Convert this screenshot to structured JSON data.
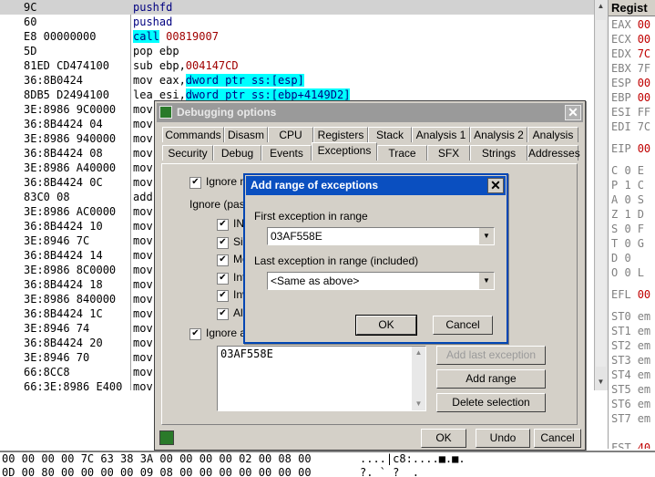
{
  "disasm": {
    "rows": [
      {
        "hex": "9C",
        "ins": "pushfd"
      },
      {
        "hex": "60",
        "ins": "pushad"
      },
      {
        "hex": "E8 00000000",
        "ins_kw": "call",
        "ins_arg": " 00819007"
      },
      {
        "hex": "5D",
        "ins": "pop ebp"
      },
      {
        "hex": "81ED CD474100",
        "ins": "sub ebp,",
        "ins_arg2": "004147CD"
      },
      {
        "hex": "36:8B0424",
        "ins": "mov eax,",
        "ins_hl": "dword ptr ss:[esp]"
      },
      {
        "hex": "8DB5 D2494100",
        "ins": "lea esi,",
        "ins_hl": "dword ptr ss:[ebp+4149D2]"
      },
      {
        "hex": "3E:8986 9C0000",
        "ins": "mov"
      },
      {
        "hex": "36:8B4424 04",
        "ins": "mov"
      },
      {
        "hex": "3E:8986 940000",
        "ins": "mov"
      },
      {
        "hex": "36:8B4424 08",
        "ins": "mov"
      },
      {
        "hex": "3E:8986 A40000",
        "ins": "mov"
      },
      {
        "hex": "36:8B4424 0C",
        "ins": "mov"
      },
      {
        "hex": "83C0 08",
        "ins": "add"
      },
      {
        "hex": "3E:8986 AC0000",
        "ins": "mov"
      },
      {
        "hex": "36:8B4424 10",
        "ins": "mov"
      },
      {
        "hex": "3E:8946 7C",
        "ins": "mov"
      },
      {
        "hex": "36:8B4424 14",
        "ins": "mov"
      },
      {
        "hex": "3E:8986 8C0000",
        "ins": "mov"
      },
      {
        "hex": "36:8B4424 18",
        "ins": "mov"
      },
      {
        "hex": "3E:8986 840000",
        "ins": "mov"
      },
      {
        "hex": "36:8B4424 1C",
        "ins": "mov"
      },
      {
        "hex": "3E:8946 74",
        "ins": "mov"
      },
      {
        "hex": "36:8B4424 20",
        "ins": "mov"
      },
      {
        "hex": "3E:8946 70",
        "ins": "mov"
      },
      {
        "hex": "66:8CC8",
        "ins": "mov"
      },
      {
        "hex": "66:3E:8986 E400",
        "ins": "mov"
      }
    ]
  },
  "registers": {
    "title": "Regist",
    "rows": [
      {
        "name": "EAX",
        "val": "00",
        "gray": false
      },
      {
        "name": "ECX",
        "val": "00",
        "gray": false
      },
      {
        "name": "EDX",
        "val": "7C",
        "gray": false
      },
      {
        "name": "EBX",
        "val": "7F",
        "gray": true
      },
      {
        "name": "ESP",
        "val": "00",
        "gray": false
      },
      {
        "name": "EBP",
        "val": "00",
        "gray": false
      },
      {
        "name": "ESI",
        "val": "FF",
        "gray": true
      },
      {
        "name": "EDI",
        "val": "7C",
        "gray": true
      },
      {
        "name": "EIP",
        "val": "00",
        "gray": false
      },
      {
        "name": "C 0",
        "val": "E",
        "gray": true
      },
      {
        "name": "P 1",
        "val": "C",
        "gray": true
      },
      {
        "name": "A 0",
        "val": "S",
        "gray": true
      },
      {
        "name": "Z 1",
        "val": "D",
        "gray": true
      },
      {
        "name": "S 0",
        "val": "F",
        "gray": true
      },
      {
        "name": "T 0",
        "val": "G",
        "gray": true
      },
      {
        "name": "D 0",
        "val": "",
        "gray": true
      },
      {
        "name": "O 0",
        "val": "L",
        "gray": true
      },
      {
        "name": "EFL",
        "val": "00",
        "gray": false
      },
      {
        "name": "ST0",
        "val": "em",
        "gray": true
      },
      {
        "name": "ST1",
        "val": "em",
        "gray": true
      },
      {
        "name": "ST2",
        "val": "em",
        "gray": true
      },
      {
        "name": "ST3",
        "val": "em",
        "gray": true
      },
      {
        "name": "ST4",
        "val": "em",
        "gray": true
      },
      {
        "name": "ST5",
        "val": "em",
        "gray": true
      },
      {
        "name": "ST6",
        "val": "em",
        "gray": true
      },
      {
        "name": "ST7",
        "val": "em",
        "gray": true
      },
      {
        "name": "FST",
        "val": "40",
        "gray": false
      }
    ]
  },
  "dump": {
    "row1_hex": "00 00 00 00 7C 63 38 3A 00 00 00 00 02 00 08 00",
    "row1_ascii": "....|c8:....■.■.",
    "row2_hex": "0D 00 80 00 00 00 00 09 08 00 00 00 00 00 00 00",
    "row2_ascii": "?. ` ?  ."
  },
  "debugging_options": {
    "title": "Debugging options",
    "tabs_row1": [
      "Commands",
      "Disasm",
      "CPU",
      "Registers",
      "Stack",
      "Analysis 1",
      "Analysis 2",
      "Analysis 3"
    ],
    "tabs_row2": [
      "Security",
      "Debug",
      "Events",
      "Exceptions",
      "Trace",
      "SFX",
      "Strings",
      "Addresses"
    ],
    "active_tab": "Exceptions",
    "ignore_memory": "Ignore m",
    "ignore_pass": "Ignore (pass",
    "sub_items": [
      "IN",
      "Si",
      "Me",
      "Int",
      "Inv",
      "All"
    ],
    "ignore_also": "Ignore al",
    "list_items": [
      "03AF558E"
    ],
    "add_last_exception": "Add last exception",
    "add_range": "Add range",
    "delete_selection": "Delete selection",
    "ok": "OK",
    "undo": "Undo",
    "cancel": "Cancel"
  },
  "add_range_dialog": {
    "title": "Add range of exceptions",
    "first_label": "First exception in range",
    "first_value": "03AF558E",
    "last_label": "Last exception in range (included)",
    "last_value": "<Same as above>",
    "ok": "OK",
    "cancel": "Cancel"
  }
}
